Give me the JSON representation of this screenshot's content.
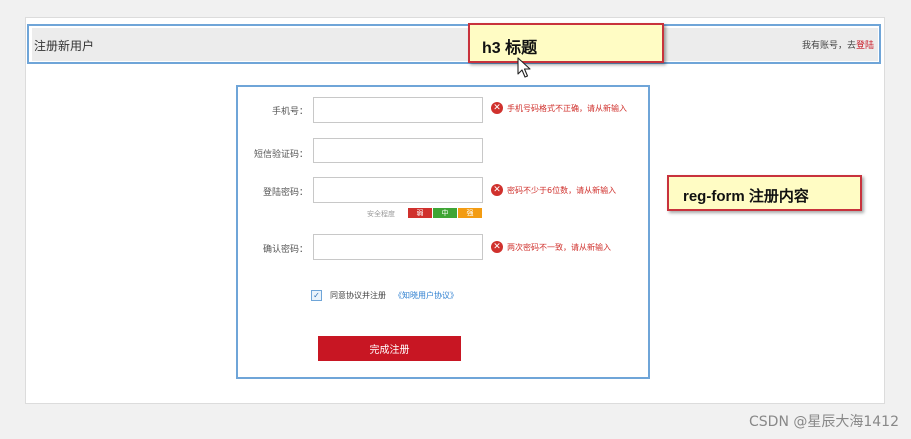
{
  "header": {
    "title": "注册新用户",
    "have_account": "我有账号，去",
    "login_link": "登陆"
  },
  "annotations": {
    "h3_callout": "h3 标题",
    "form_callout": "reg-form 注册内容"
  },
  "form": {
    "phone": {
      "label": "手机号：",
      "value": "",
      "error": "手机号码格式不正确，请从新输入"
    },
    "sms": {
      "label": "短信验证码：",
      "value": ""
    },
    "password": {
      "label": "登陆密码：",
      "value": "",
      "error": "密码不少于6位数，请从新输入"
    },
    "strength": {
      "label": "安全程度",
      "levels": [
        {
          "name": "弱",
          "color": "#d0312d"
        },
        {
          "name": "中",
          "color": "#3fa535"
        },
        {
          "name": "强",
          "color": "#f39c12"
        }
      ]
    },
    "confirm": {
      "label": "确认密码：",
      "value": "",
      "error": "两次密码不一致，请从新输入"
    },
    "agree": {
      "text": "同意协议并注册",
      "link": "《知晓用户协议》",
      "checked": true
    },
    "submit_label": "完成注册"
  },
  "watermark": "CSDN @星辰大海1412",
  "colors": {
    "brand_red": "#c81623",
    "outline_blue": "#6fa5d8",
    "error_red": "#d0312d"
  }
}
